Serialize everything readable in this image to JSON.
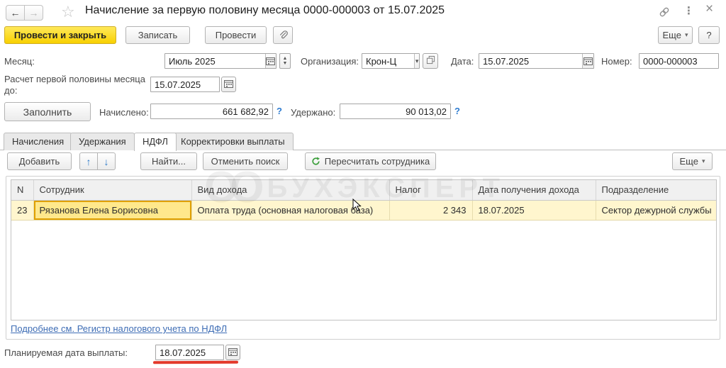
{
  "window": {
    "title": "Начисление за первую половину месяца 0000-000003 от 15.07.2025",
    "back_glyph": "←",
    "forward_glyph": "→",
    "favorite_glyph": "☆",
    "more_dots_glyph": "⋮",
    "close_glyph": "×"
  },
  "command_bar": {
    "post_and_close": "Провести и закрыть",
    "save": "Записать",
    "post": "Провести",
    "more": "Еще",
    "help": "?"
  },
  "header_fields": {
    "month_label": "Месяц:",
    "month_value": "Июль 2025",
    "org_label": "Организация:",
    "org_value": "Крон-Ц",
    "date_label": "Дата:",
    "date_value": "15.07.2025",
    "number_label": "Номер:",
    "number_value": "0000-000003",
    "half_month_label": "Расчет первой половины месяца до:",
    "half_month_value": "15.07.2025"
  },
  "totals": {
    "fill_button": "Заполнить",
    "accrued_label": "Начислено:",
    "accrued_value": "661 682,92",
    "withheld_label": "Удержано:",
    "withheld_value": "90 013,02",
    "help": "?"
  },
  "tabs": {
    "accruals": "Начисления",
    "deductions": "Удержания",
    "ndfl": "НДФЛ",
    "corrections": "Корректировки выплаты"
  },
  "table_toolbar": {
    "add": "Добавить",
    "move_up_glyph": "↑",
    "move_down_glyph": "↓",
    "find": "Найти...",
    "cancel_search": "Отменить поиск",
    "recalc": "Пересчитать сотрудника",
    "more": "Еще"
  },
  "table": {
    "columns": [
      "N",
      "Сотрудник",
      "Вид дохода",
      "Налог",
      "Дата получения дохода",
      "Подразделение"
    ],
    "row": {
      "n": "23",
      "employee": "Рязанова Елена Борисовна",
      "income_type": "Оплата труда (основная налоговая база)",
      "tax": "2 343",
      "income_date": "18.07.2025",
      "department": "Сектор дежурной службы"
    }
  },
  "footer": {
    "link": "Подробнее см. Регистр налогового учета по НДФЛ",
    "planned_date_label": "Планируемая дата выплаты:",
    "planned_date_value": "18.07.2025"
  },
  "watermark": {
    "logo": "ОО",
    "text": "БУХЭКСПЕРТ"
  },
  "colors": {
    "accent_yellow": "#f8d001",
    "selected_row": "#fff6ce",
    "selected_cell_border": "#dfa000",
    "link_blue": "#3e6db5",
    "help_blue": "#2f7cd0",
    "annotation_red": "#e3392b",
    "refresh_green": "#3a9e3a",
    "arrow_blue": "#2a78c8"
  }
}
